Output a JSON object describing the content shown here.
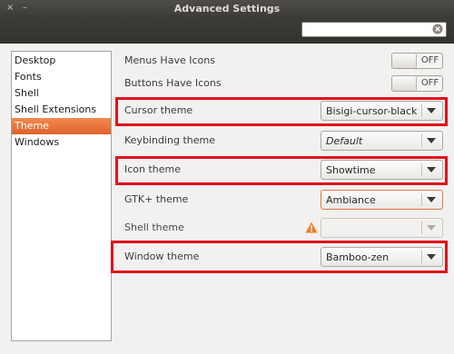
{
  "window": {
    "title": "Advanced Settings",
    "close_glyph": "×",
    "minimize_glyph": "–"
  },
  "search": {
    "value": "",
    "placeholder": ""
  },
  "sidebar": {
    "items": [
      {
        "label": "Desktop",
        "active": false
      },
      {
        "label": "Fonts",
        "active": false
      },
      {
        "label": "Shell",
        "active": false
      },
      {
        "label": "Shell Extensions",
        "active": false
      },
      {
        "label": "Theme",
        "active": true
      },
      {
        "label": "Windows",
        "active": false
      }
    ]
  },
  "settings": {
    "menus_have_icons": {
      "label": "Menus Have Icons",
      "state": "OFF"
    },
    "buttons_have_icons": {
      "label": "Buttons Have Icons",
      "state": "OFF"
    },
    "cursor_theme": {
      "label": "Cursor theme",
      "value": "Bisigi-cursor-black",
      "highlighted": true
    },
    "keybinding_theme": {
      "label": "Keybinding theme",
      "value": "Default"
    },
    "icon_theme": {
      "label": "Icon theme",
      "value": "Showtime",
      "highlighted": true
    },
    "gtk_theme": {
      "label": "GTK+ theme",
      "value": "Ambiance"
    },
    "shell_theme": {
      "label": "Shell theme",
      "value": "",
      "warning": true,
      "disabled": true
    },
    "window_theme": {
      "label": "Window theme",
      "value": "Bamboo-zen",
      "highlighted": true
    }
  },
  "colors": {
    "accent": "#e0622a",
    "highlight_box": "#e2121b",
    "titlebar": "#3d3b37",
    "warning": "#f07c2a"
  },
  "icons": {
    "search_clear": "clear-search-icon",
    "warning": "warning-icon",
    "dropdown": "chevron-down-icon"
  }
}
